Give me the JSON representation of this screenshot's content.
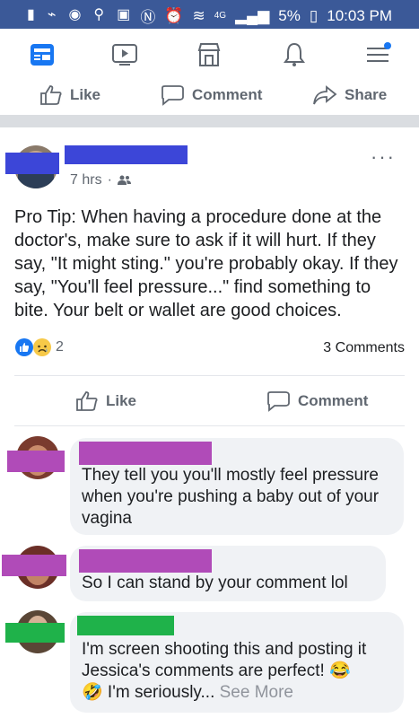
{
  "statusbar": {
    "battery": "5%",
    "time": "10:03 PM",
    "network": "4G"
  },
  "nav": {
    "items": [
      "news-feed-icon",
      "watch-icon",
      "marketplace-icon",
      "notifications-icon",
      "menu-icon"
    ],
    "accent": "#1877f2"
  },
  "top_actions": {
    "like": "Like",
    "comment": "Comment",
    "share": "Share"
  },
  "post": {
    "time": "7 hrs",
    "separator": "·",
    "more": "···",
    "text": "Pro Tip: When having a procedure done at the doctor's, make sure to ask if it will hurt. If they say, \"It might sting.\" you're probably okay. If they say, \"You'll feel pressure...\" find something to bite. Your belt or wallet are good choices.",
    "reaction_count": "2",
    "comments_count": "3 Comments",
    "actions": {
      "like": "Like",
      "comment": "Comment"
    }
  },
  "comments": [
    {
      "text": "They tell you you'll mostly feel pressure when you're pushing a baby out of your vagina",
      "redact_color": "#b04bb8"
    },
    {
      "text": "So I can stand by your comment lol",
      "redact_color": "#b04bb8"
    },
    {
      "text": "I'm screen shooting this and posting it Jessica's comments are perfect! 😂",
      "text2": "🤣 I'm seriously... ",
      "see_more": "See More",
      "redact_color": "#1fb24a"
    }
  ],
  "colors": {
    "brand": "#3b5998",
    "redact_blue": "#3c46d8"
  }
}
